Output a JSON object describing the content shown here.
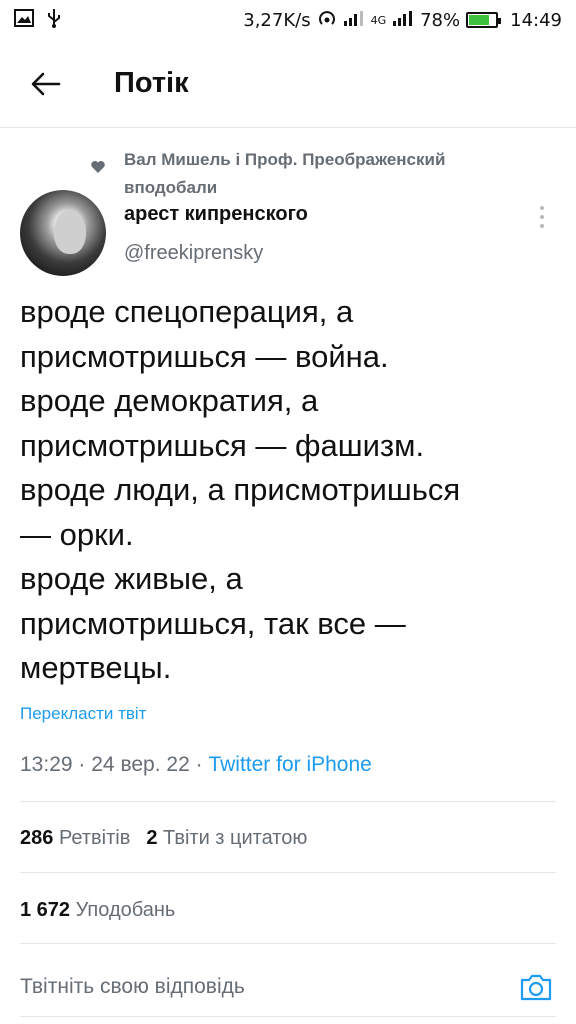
{
  "status_bar": {
    "speed": "3,27K/s",
    "network": "4G",
    "battery": "78%",
    "battery_level": 0.78,
    "time": "14:49"
  },
  "header": {
    "title": "Потік"
  },
  "tweet": {
    "social_context_line1": "Вал Мишель і Проф. Преображенский",
    "social_context_line2": "вподобали",
    "author_name": "арест кипренского",
    "author_handle": "@freekiprensky",
    "text": "вроде спецоперация, а\nприсмотришься — война.\nвроде демократия, а\nприсмотришься — фашизм.\nвроде люди, а присмотришься\n— орки.\nвроде живые, а\nприсмотришься, так все —\nмертвецы.",
    "translate_label": "Перекласти твіт",
    "time": "13:29",
    "date": "24 вер. 22",
    "separator": "·",
    "source": "Twitter for iPhone"
  },
  "stats": {
    "retweets_count": "286",
    "retweets_label": "Ретвітів",
    "quotes_count": "2",
    "quotes_label": "Твіти з цитатою",
    "likes_count": "1 672",
    "likes_label": "Уподобань"
  },
  "reply": {
    "placeholder": "Твітніть свою відповідь"
  },
  "colors": {
    "accent": "#1d9bf0",
    "secondary_text": "#666d74",
    "battery": "#3ec13e"
  }
}
